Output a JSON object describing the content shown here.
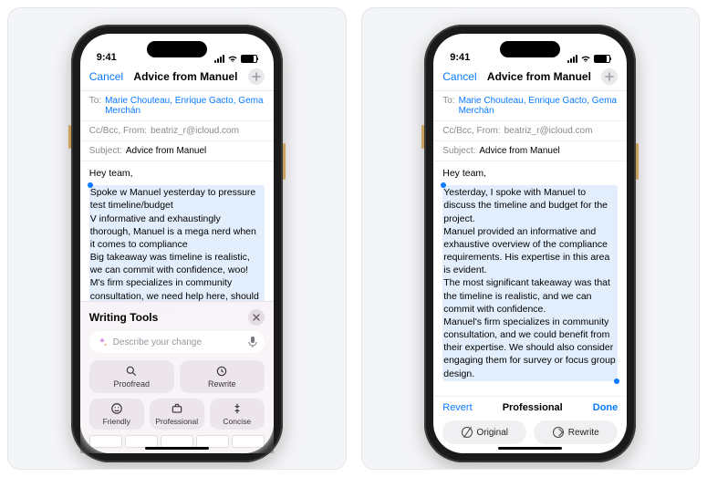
{
  "status": {
    "time": "9:41"
  },
  "nav": {
    "cancel": "Cancel",
    "title": "Advice from Manuel"
  },
  "fields": {
    "to_label": "To:",
    "to_value": "Marie Chouteau, Enrique Gacto, Gema Merchán",
    "cc_label": "Cc/Bcc, From:",
    "cc_value": "beatriz_r@icloud.com",
    "subject_label": "Subject:",
    "subject_value": "Advice from Manuel"
  },
  "email_left": {
    "greeting": "Hey team,",
    "body": "Spoke w Manuel yesterday to pressure test timeline/budget\nV informative and exhaustingly thorough, Manuel is a mega nerd when it comes to compliance\nBig takeaway was timeline is realistic, we can commit with confidence, woo!\nM's firm specializes in community consultation, we need help here, should consider engaging"
  },
  "email_right": {
    "greeting": "Hey team,",
    "body": "Yesterday, I spoke with Manuel to discuss the timeline and budget for the project.\nManuel provided an informative and exhaustive overview of the compliance requirements. His expertise in this area is evident.\nThe most significant takeaway was that the timeline is realistic, and we can commit with confidence.\nManuel's firm specializes in community consultation, and we could benefit from their expertise. We should also consider engaging them for survey or focus group design."
  },
  "writing_tools": {
    "title": "Writing Tools",
    "placeholder": "Describe your change",
    "proofread": "Proofread",
    "rewrite": "Rewrite",
    "friendly": "Friendly",
    "professional": "Professional",
    "concise": "Concise"
  },
  "review": {
    "revert": "Revert",
    "mode": "Professional",
    "done": "Done",
    "original": "Original",
    "rewrite": "Rewrite"
  }
}
